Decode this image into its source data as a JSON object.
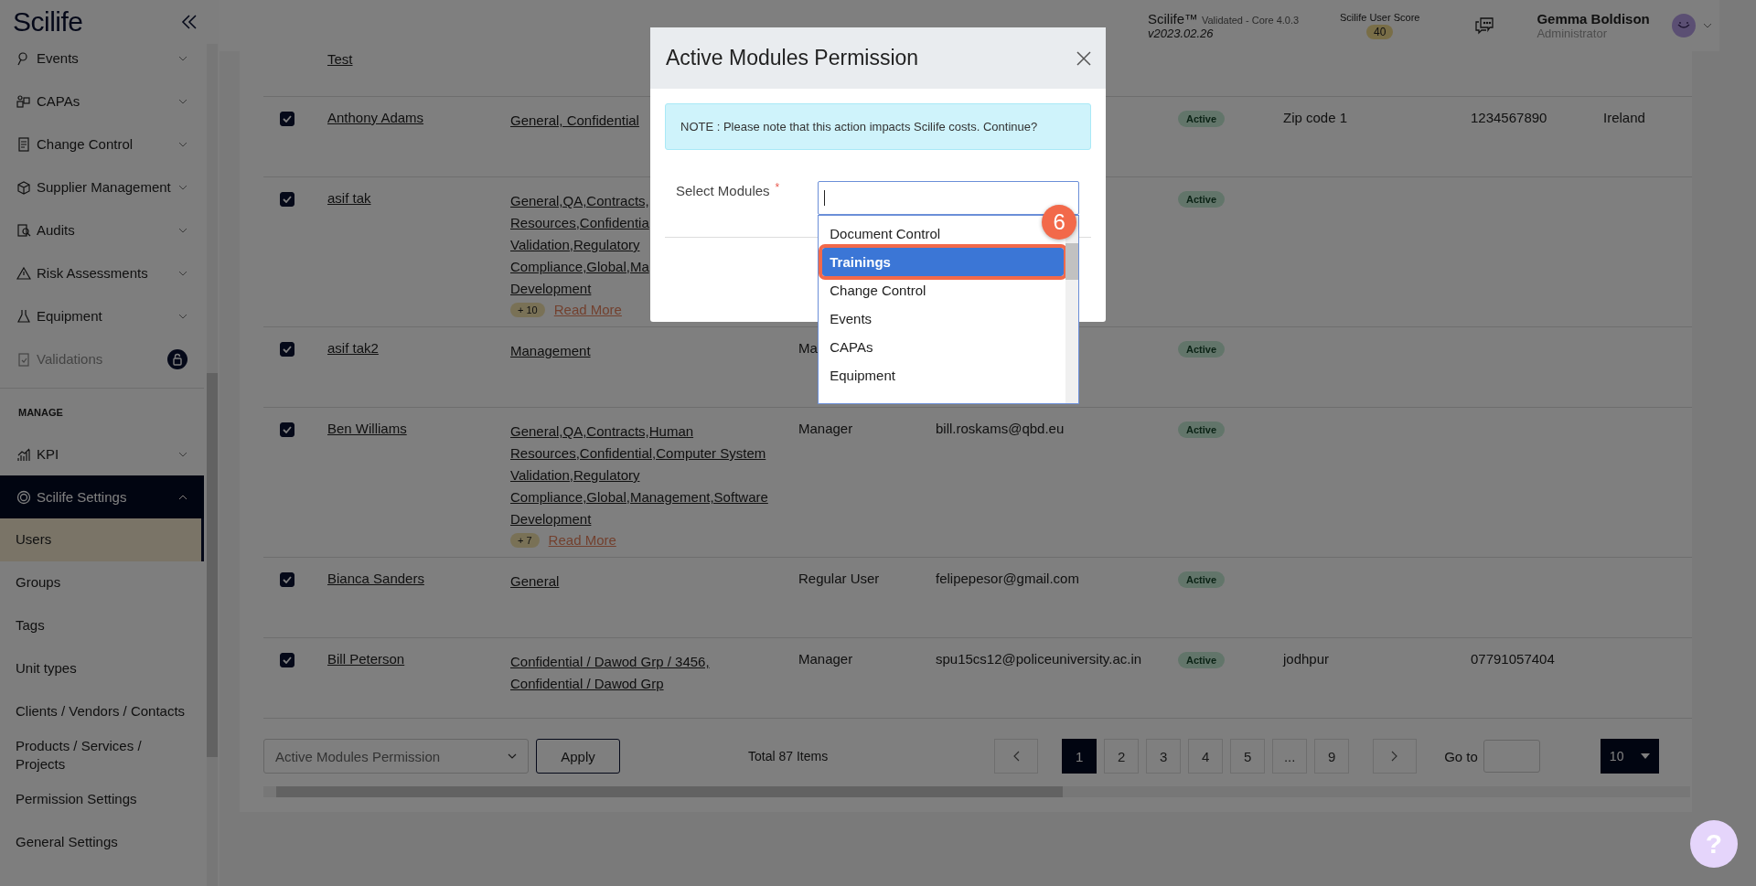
{
  "sidebar": {
    "logo": "Scilife",
    "items": [
      {
        "label": "Events",
        "disabled": false
      },
      {
        "label": "CAPAs",
        "disabled": false
      },
      {
        "label": "Change Control",
        "disabled": false
      },
      {
        "label": "Supplier Management",
        "disabled": false
      },
      {
        "label": "Audits",
        "disabled": false
      },
      {
        "label": "Risk Assessments",
        "disabled": false
      },
      {
        "label": "Equipment",
        "disabled": false
      },
      {
        "label": "Validations",
        "disabled": true
      }
    ],
    "section": "MANAGE",
    "manage_items": [
      {
        "label": "KPI",
        "expanded": false
      },
      {
        "label": "Scilife Settings",
        "expanded": true,
        "children": [
          {
            "label": "Users",
            "selected": true
          },
          {
            "label": "Groups",
            "selected": false
          },
          {
            "label": "Tags",
            "selected": false
          },
          {
            "label": "Unit types",
            "selected": false
          },
          {
            "label": "Clients / Vendors / Contacts",
            "selected": false
          },
          {
            "label": "Products / Services / Projects",
            "selected": false
          },
          {
            "label": "Permission Settings",
            "selected": false
          },
          {
            "label": "General Settings",
            "selected": false
          }
        ]
      }
    ]
  },
  "header": {
    "product": "Scilife™",
    "edition": "Validated - Core 4.0.3",
    "version": "v2023.02.26",
    "score_label": "Scilife User Score",
    "score": "40",
    "user_name": "Gemma Boldison",
    "user_role": "Administrator"
  },
  "table": {
    "partial_row": {
      "name": "Test"
    },
    "rows": [
      {
        "checked": true,
        "name": "Anthony Adams",
        "groups": [
          "General, Confidential"
        ],
        "extra": "",
        "read_more": "",
        "role": "",
        "email": "",
        "status": "Active",
        "zip": "Zip code 1",
        "phone": "1234567890",
        "country": "Ireland"
      },
      {
        "checked": true,
        "name": "asif tak",
        "groups": [
          "General,QA,Contracts,",
          "Resources,Confidentia",
          "Validation,Regulatory",
          "Compliance,Global,Ma",
          "Development"
        ],
        "extra": "+ 10",
        "read_more": "Read More",
        "role": "",
        "email": "",
        "status": "Active",
        "zip": "",
        "phone": "",
        "country": ""
      },
      {
        "checked": true,
        "name": "asif tak2",
        "groups": [
          "Management"
        ],
        "extra": "",
        "read_more": "",
        "role": "Ma",
        "email": "",
        "status": "Active",
        "zip": "",
        "phone": "",
        "country": ""
      },
      {
        "checked": true,
        "name": "Ben Williams",
        "groups": [
          "General,QA,Contracts,Human",
          "Resources,Confidential,Computer System",
          "Validation,Regulatory",
          "Compliance,Global,Management,Software",
          "Development"
        ],
        "extra": "+ 7",
        "read_more": "Read More",
        "role": "Manager",
        "email": "bill.roskams@qbd.eu",
        "status": "Active",
        "zip": "",
        "phone": "",
        "country": ""
      },
      {
        "checked": true,
        "name": "Bianca Sanders",
        "groups": [
          "General"
        ],
        "extra": "",
        "read_more": "",
        "role": "Regular User",
        "email": "felipepesor@gmail.com",
        "status": "Active",
        "zip": "",
        "phone": "",
        "country": ""
      },
      {
        "checked": true,
        "name": "Bill Peterson",
        "groups": [
          "Confidential / Dawod Grp / 3456,",
          "Confidential / Dawod Grp"
        ],
        "extra": "",
        "read_more": "",
        "role": "Manager",
        "email": "spu15cs12@policeuniversity.ac.in",
        "status": "Active",
        "zip": "jodhpur",
        "phone": "07791057404",
        "country": ""
      }
    ]
  },
  "footer": {
    "bulk_action": "Active Modules Permission",
    "apply": "Apply",
    "total": "Total 87 Items",
    "pages": [
      {
        "label": "1",
        "selected": true
      },
      {
        "label": "2",
        "selected": false
      },
      {
        "label": "3",
        "selected": false
      },
      {
        "label": "4",
        "selected": false
      },
      {
        "label": "5",
        "selected": false
      },
      {
        "label": "...",
        "selected": false
      },
      {
        "label": "9",
        "selected": false
      }
    ],
    "goto_label": "Go to",
    "page_size": "10"
  },
  "help": "?",
  "modal": {
    "title": "Active Modules Permission",
    "note": "NOTE : Please note that this action impacts Scilife costs. Continue?",
    "field_label": "Select Modules",
    "required_mark": "*",
    "options": [
      {
        "label": "Document Control",
        "selected": false
      },
      {
        "label": "Trainings",
        "selected": true
      },
      {
        "label": "Change Control",
        "selected": false
      },
      {
        "label": "Events",
        "selected": false
      },
      {
        "label": "CAPAs",
        "selected": false
      },
      {
        "label": "Equipment",
        "selected": false
      }
    ],
    "step": "6"
  }
}
